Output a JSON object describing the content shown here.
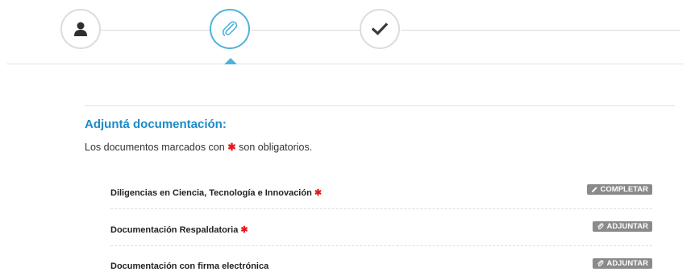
{
  "stepper": {
    "steps": [
      {
        "icon": "user-icon",
        "state": "done"
      },
      {
        "icon": "paperclip-icon",
        "state": "active"
      },
      {
        "icon": "checkmark-icon",
        "state": "pending"
      }
    ],
    "accent_color": "#4fb3d9"
  },
  "section": {
    "title": "Adjuntá documentación:",
    "note_before": "Los documentos marcados con",
    "note_required_mark": "✱",
    "note_after": "son obligatorios.",
    "title_color": "#1b8bc7",
    "required_color": "#e8191d"
  },
  "documents": [
    {
      "name": "Diligencias en Ciencia, Tecnología e Innovación",
      "required_mark": "✱",
      "action_label": "COMPLETAR",
      "action_icon": "pencil-icon"
    },
    {
      "name": "Documentación Respaldatoria",
      "required_mark": "✱",
      "action_label": "ADJUNTAR",
      "action_icon": "paperclip-icon"
    },
    {
      "name": "Documentación con firma electrónica",
      "required_mark": "",
      "action_label": "ADJUNTAR",
      "action_icon": "paperclip-icon"
    }
  ]
}
